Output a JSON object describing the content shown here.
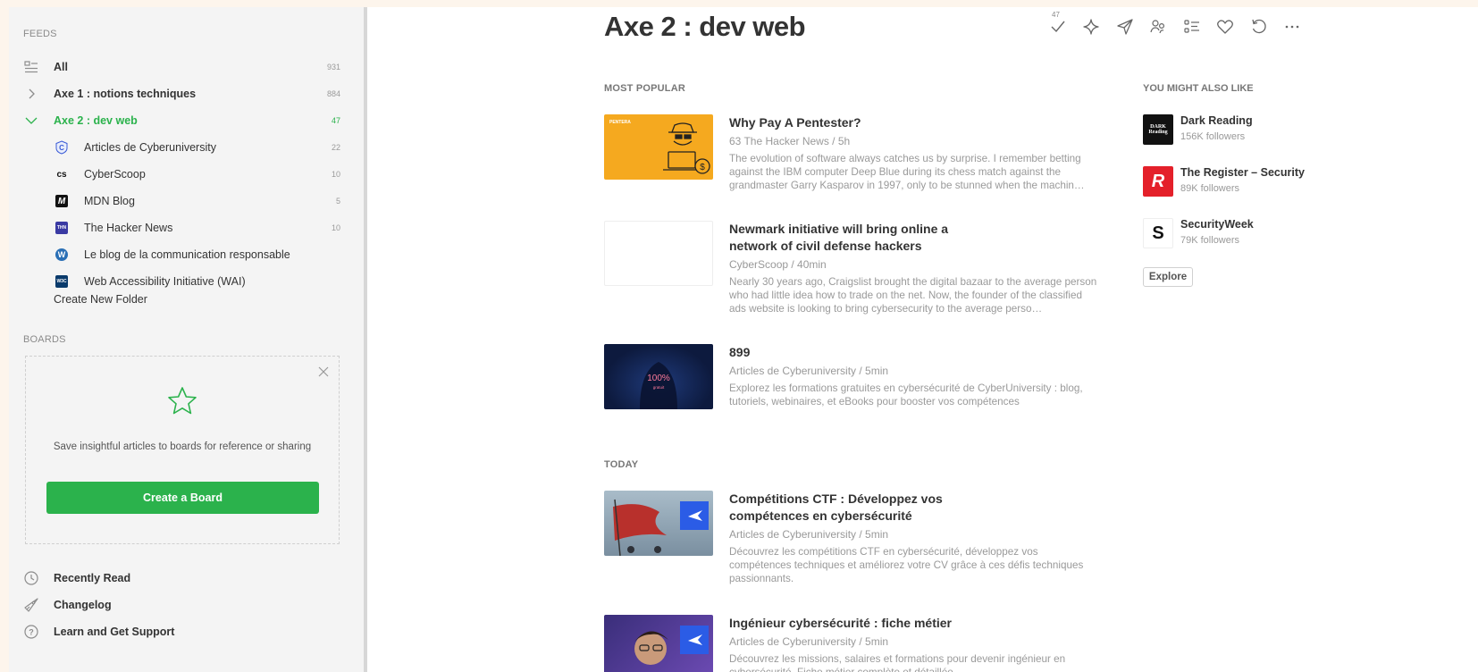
{
  "colors": {
    "accent": "#2bb24c",
    "page_bg": "#fdf5ec",
    "sidebar_bg": "#f4f4f4"
  },
  "sidebar": {
    "feeds_title": "FEEDS",
    "feeds": [
      {
        "label": "All",
        "count": "931",
        "icon": "all-feeds-icon"
      },
      {
        "label": "Axe 1 : notions techniques",
        "count": "884",
        "icon": "chevron-right-icon"
      },
      {
        "label": "Axe 2 : dev web",
        "count": "47",
        "icon": "chevron-down-icon",
        "active": true
      }
    ],
    "sources": [
      {
        "label": "Articles de Cyberuniversity",
        "count": "22",
        "icon": "cyberuniversity-favicon",
        "badge": "C"
      },
      {
        "label": "CyberScoop",
        "count": "10",
        "icon": "cyberscoop-favicon",
        "badge": "cs"
      },
      {
        "label": "MDN Blog",
        "count": "5",
        "icon": "mdn-favicon",
        "badge": "M"
      },
      {
        "label": "The Hacker News",
        "count": "10",
        "icon": "hackernews-favicon",
        "badge": "THN"
      },
      {
        "label": "Le blog de la communication responsable",
        "count": "",
        "icon": "wordpress-favicon",
        "badge": "W"
      },
      {
        "label": "Web Accessibility Initiative (WAI)",
        "count": "",
        "icon": "w3c-favicon",
        "badge": "W3C"
      }
    ],
    "create_folder": "Create New Folder",
    "boards_title": "BOARDS",
    "boards_text": "Save insightful articles to boards for reference or sharing",
    "create_board": "Create a Board",
    "bottom": [
      {
        "label": "Recently Read",
        "icon": "clock-icon"
      },
      {
        "label": "Changelog",
        "icon": "rocket-icon"
      },
      {
        "label": "Learn and Get Support",
        "icon": "help-icon"
      }
    ]
  },
  "main": {
    "title": "Axe 2 : dev web",
    "toolbar": {
      "mark_read_count": "47",
      "icons": [
        "mark-read-icon",
        "ai-sparkle-icon",
        "send-icon",
        "team-icon",
        "list-view-icon",
        "favorite-icon",
        "refresh-icon",
        "more-icon"
      ]
    },
    "most_popular_title": "MOST POPULAR",
    "today_title": "TODAY",
    "most_popular": [
      {
        "title": "Why Pay A Pentester?",
        "meta": "63  The Hacker News / 5h",
        "desc": "The evolution of software always catches us by surprise. I remember betting against the IBM computer Deep Blue during its chess match against the grandmaster Garry Kasparov in 1997, only to be stunned when the machin…",
        "thumb_label": "PENTERA"
      },
      {
        "title": "Newmark initiative will bring online a network of civil defense hackers",
        "meta": "CyberScoop / 40min",
        "desc": "Nearly 30 years ago, Craigslist brought the digital bazaar to the average person who had little idea how to trade on the net. Now, the founder of the classified ads website is looking to bring cybersecurity to the average perso…"
      },
      {
        "title": "899",
        "meta": "Articles de Cyberuniversity / 5min",
        "desc": "Explorez les formations gratuites en cybersécurité de CyberUniversity : blog, tutoriels, webinaires, et eBooks pour booster vos compétences",
        "thumb_label": "100%",
        "thumb_sub": "gratuit"
      }
    ],
    "today": [
      {
        "title": "Compétitions CTF : Développez vos compétences en cybersécurité",
        "meta": "Articles de Cyberuniversity / 5min",
        "desc": "Découvrez les compétitions CTF en cybersécurité, développez vos compétences techniques et améliorez votre CV grâce à ces défis techniques passionnants."
      },
      {
        "title": "Ingénieur cybersécurité : fiche métier",
        "meta": "Articles de Cyberuniversity / 5min",
        "desc": "Découvrez les missions, salaires et formations pour devenir ingénieur en cybersécurité. Fiche métier complète et détaillée."
      }
    ],
    "you_might_also_like": {
      "title": "YOU MIGHT ALSO LIKE",
      "items": [
        {
          "name": "Dark Reading",
          "followers": "156K followers",
          "logo_text": "DARK Reading"
        },
        {
          "name": "The Register – Security",
          "followers": "89K followers",
          "logo_text": "R"
        },
        {
          "name": "SecurityWeek",
          "followers": "79K followers",
          "logo_text": "S"
        }
      ],
      "explore": "Explore"
    }
  }
}
